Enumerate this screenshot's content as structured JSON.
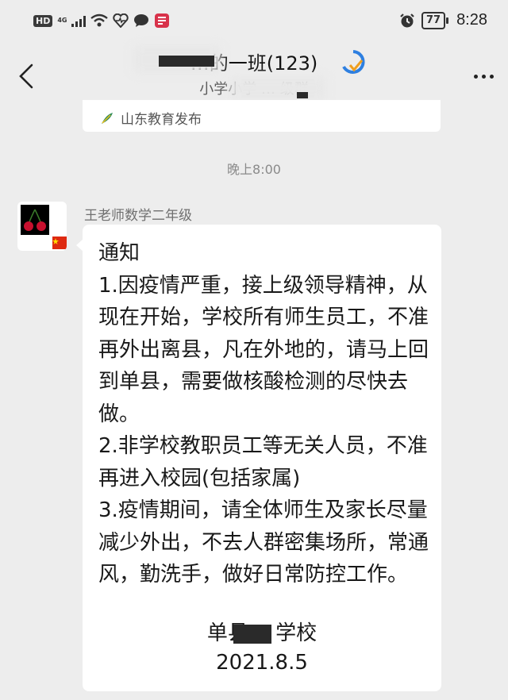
{
  "status_bar": {
    "hd": "HD",
    "network": "4G",
    "battery": "77",
    "time": "8:28"
  },
  "header": {
    "title": "…的一班(123)",
    "subtitle": "小学小学 … 级群"
  },
  "source": {
    "name": "山东教育发布"
  },
  "time_divider": "晚上8:00",
  "message": {
    "sender": "王老师数学二年级",
    "body": "通知\n1.因疫情严重，接上级领导精神，从现在开始，学校所有师生员工，不准再外出离县，凡在外地的，请马上回到单县，需要做核酸检测的尽快去做。\n2.非学校教职员工等无关人员，不准再进入校园(包括家属)\n3.疫情期间，请全体师生及家长尽量减少外出，不去人群密集场所，常通风，勤洗手，做好日常防控工作。",
    "signature": "单县… 学校",
    "date": "2021.8.5"
  },
  "icons": [
    "back-arrow-icon",
    "more-dots-icon",
    "signal-icon",
    "wifi-icon",
    "heart-icon",
    "chat-icon",
    "app-icon",
    "alarm-icon",
    "battery-icon",
    "feather-icon"
  ]
}
